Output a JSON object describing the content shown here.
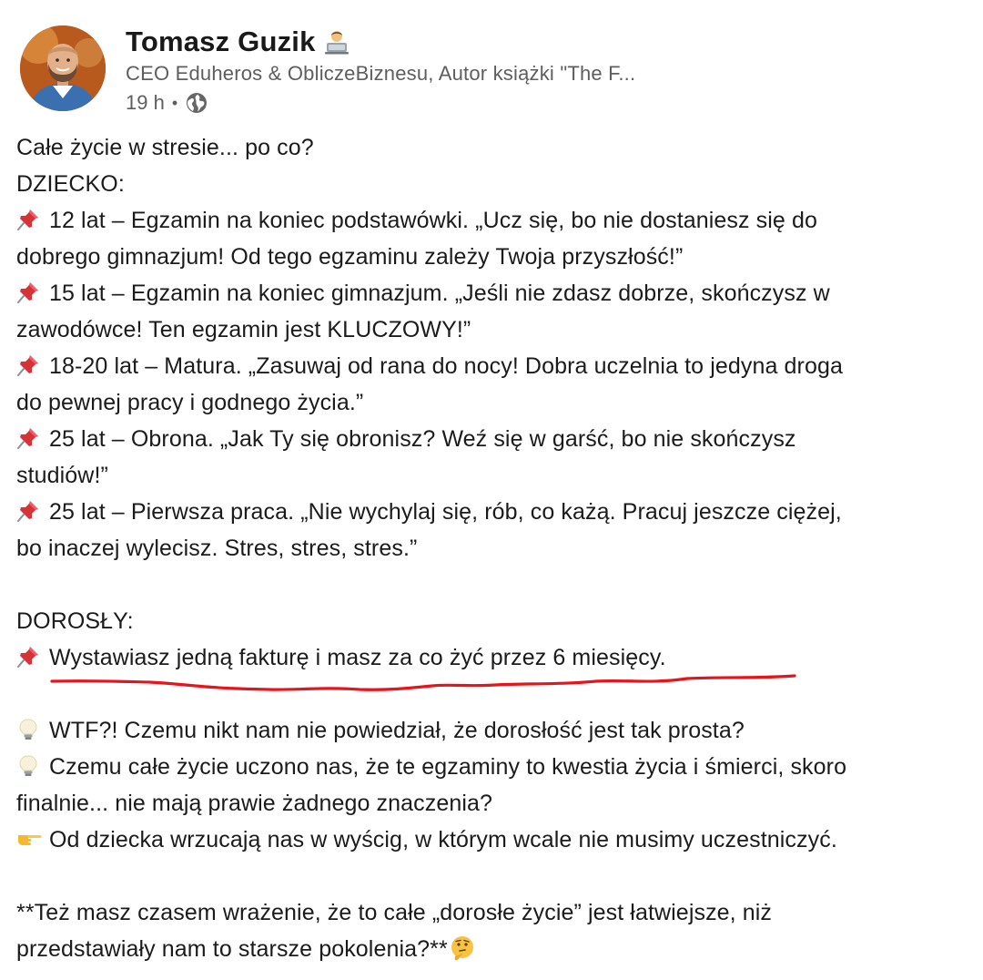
{
  "author": {
    "name": "Tomasz Guzik",
    "name_emoji": "technologist-emoji",
    "headline": "CEO Eduheros & ObliczeBiznesu, Autor książki \"The F...",
    "time": "19 h",
    "separator": "•",
    "visibility_icon": "globe-icon"
  },
  "post": {
    "lines": [
      {
        "text": "Całe życie w stresie... po co?"
      },
      {
        "text": "DZIECKO:"
      },
      {
        "icon": "pushpin-icon",
        "text": "12 lat – Egzamin na koniec podstawówki. „Ucz się, bo nie dostaniesz się do"
      },
      {
        "text": "dobrego gimnazjum! Od tego egzaminu zależy Twoja przyszłość!”"
      },
      {
        "icon": "pushpin-icon",
        "text": "15 lat – Egzamin na koniec gimnazjum. „Jeśli nie zdasz dobrze, skończysz w"
      },
      {
        "text": "zawodówce! Ten egzamin jest KLUCZOWY!”"
      },
      {
        "icon": "pushpin-icon",
        "text": "18-20 lat – Matura. „Zasuwaj od rana do nocy! Dobra uczelnia to jedyna droga"
      },
      {
        "text": "do pewnej pracy i godnego życia.”"
      },
      {
        "icon": "pushpin-icon",
        "text": "25 lat – Obrona. „Jak Ty się obronisz? Weź się w garść, bo nie skończysz"
      },
      {
        "text": "studiów!”"
      },
      {
        "icon": "pushpin-icon",
        "text": "25 lat – Pierwsza praca. „Nie wychylaj się, rób, co każą. Pracuj jeszcze ciężej,"
      },
      {
        "text": "bo inaczej wylecisz. Stres, stres, stres.”"
      },
      {
        "blank": true
      },
      {
        "text": "DOROSŁY:"
      },
      {
        "icon": "pushpin-icon",
        "text": "Wystawiasz jedną fakturę i masz za co żyć przez 6 miesięcy."
      },
      {
        "blank": true
      },
      {
        "icon": "light-bulb-icon",
        "text": "WTF?! Czemu nikt nam nie powiedział, że dorosłość jest tak prosta?"
      },
      {
        "icon": "light-bulb-icon",
        "text": "Czemu całe życie uczono nas, że te egzaminy to kwestia życia i śmierci, skoro"
      },
      {
        "text": "finalnie... nie mają prawie żadnego znaczenia?"
      },
      {
        "icon": "pointing-hand-icon",
        "text": "Od dziecka wrzucają nas w wyścig, w którym wcale nie musimy uczestniczyć."
      },
      {
        "blank": true
      },
      {
        "text": "**Też masz czasem wrażenie, że to całe „dorosłe życie” jest łatwiejsze, niż"
      },
      {
        "text": "przedstawiały nam to starsze pokolenia?**",
        "end_icon": "thinking-face-icon"
      }
    ]
  },
  "annotation": {
    "underline_color": "#e8141c"
  }
}
